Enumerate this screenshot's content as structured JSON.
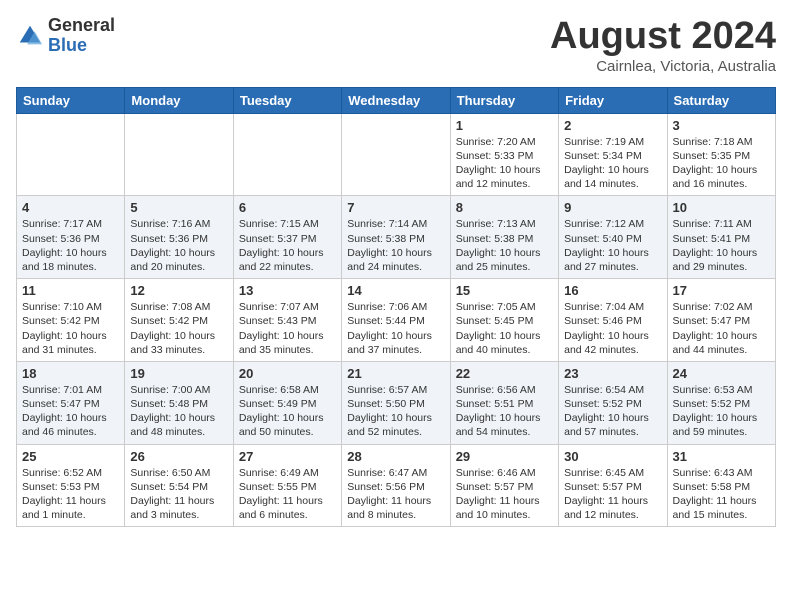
{
  "header": {
    "logo_general": "General",
    "logo_blue": "Blue",
    "month_year": "August 2024",
    "location": "Cairnlea, Victoria, Australia"
  },
  "weekdays": [
    "Sunday",
    "Monday",
    "Tuesday",
    "Wednesday",
    "Thursday",
    "Friday",
    "Saturday"
  ],
  "weeks": [
    [
      {
        "day": "",
        "info": ""
      },
      {
        "day": "",
        "info": ""
      },
      {
        "day": "",
        "info": ""
      },
      {
        "day": "",
        "info": ""
      },
      {
        "day": "1",
        "info": "Sunrise: 7:20 AM\nSunset: 5:33 PM\nDaylight: 10 hours\nand 12 minutes."
      },
      {
        "day": "2",
        "info": "Sunrise: 7:19 AM\nSunset: 5:34 PM\nDaylight: 10 hours\nand 14 minutes."
      },
      {
        "day": "3",
        "info": "Sunrise: 7:18 AM\nSunset: 5:35 PM\nDaylight: 10 hours\nand 16 minutes."
      }
    ],
    [
      {
        "day": "4",
        "info": "Sunrise: 7:17 AM\nSunset: 5:36 PM\nDaylight: 10 hours\nand 18 minutes."
      },
      {
        "day": "5",
        "info": "Sunrise: 7:16 AM\nSunset: 5:36 PM\nDaylight: 10 hours\nand 20 minutes."
      },
      {
        "day": "6",
        "info": "Sunrise: 7:15 AM\nSunset: 5:37 PM\nDaylight: 10 hours\nand 22 minutes."
      },
      {
        "day": "7",
        "info": "Sunrise: 7:14 AM\nSunset: 5:38 PM\nDaylight: 10 hours\nand 24 minutes."
      },
      {
        "day": "8",
        "info": "Sunrise: 7:13 AM\nSunset: 5:38 PM\nDaylight: 10 hours\nand 25 minutes."
      },
      {
        "day": "9",
        "info": "Sunrise: 7:12 AM\nSunset: 5:40 PM\nDaylight: 10 hours\nand 27 minutes."
      },
      {
        "day": "10",
        "info": "Sunrise: 7:11 AM\nSunset: 5:41 PM\nDaylight: 10 hours\nand 29 minutes."
      }
    ],
    [
      {
        "day": "11",
        "info": "Sunrise: 7:10 AM\nSunset: 5:42 PM\nDaylight: 10 hours\nand 31 minutes."
      },
      {
        "day": "12",
        "info": "Sunrise: 7:08 AM\nSunset: 5:42 PM\nDaylight: 10 hours\nand 33 minutes."
      },
      {
        "day": "13",
        "info": "Sunrise: 7:07 AM\nSunset: 5:43 PM\nDaylight: 10 hours\nand 35 minutes."
      },
      {
        "day": "14",
        "info": "Sunrise: 7:06 AM\nSunset: 5:44 PM\nDaylight: 10 hours\nand 37 minutes."
      },
      {
        "day": "15",
        "info": "Sunrise: 7:05 AM\nSunset: 5:45 PM\nDaylight: 10 hours\nand 40 minutes."
      },
      {
        "day": "16",
        "info": "Sunrise: 7:04 AM\nSunset: 5:46 PM\nDaylight: 10 hours\nand 42 minutes."
      },
      {
        "day": "17",
        "info": "Sunrise: 7:02 AM\nSunset: 5:47 PM\nDaylight: 10 hours\nand 44 minutes."
      }
    ],
    [
      {
        "day": "18",
        "info": "Sunrise: 7:01 AM\nSunset: 5:47 PM\nDaylight: 10 hours\nand 46 minutes."
      },
      {
        "day": "19",
        "info": "Sunrise: 7:00 AM\nSunset: 5:48 PM\nDaylight: 10 hours\nand 48 minutes."
      },
      {
        "day": "20",
        "info": "Sunrise: 6:58 AM\nSunset: 5:49 PM\nDaylight: 10 hours\nand 50 minutes."
      },
      {
        "day": "21",
        "info": "Sunrise: 6:57 AM\nSunset: 5:50 PM\nDaylight: 10 hours\nand 52 minutes."
      },
      {
        "day": "22",
        "info": "Sunrise: 6:56 AM\nSunset: 5:51 PM\nDaylight: 10 hours\nand 54 minutes."
      },
      {
        "day": "23",
        "info": "Sunrise: 6:54 AM\nSunset: 5:52 PM\nDaylight: 10 hours\nand 57 minutes."
      },
      {
        "day": "24",
        "info": "Sunrise: 6:53 AM\nSunset: 5:52 PM\nDaylight: 10 hours\nand 59 minutes."
      }
    ],
    [
      {
        "day": "25",
        "info": "Sunrise: 6:52 AM\nSunset: 5:53 PM\nDaylight: 11 hours\nand 1 minute."
      },
      {
        "day": "26",
        "info": "Sunrise: 6:50 AM\nSunset: 5:54 PM\nDaylight: 11 hours\nand 3 minutes."
      },
      {
        "day": "27",
        "info": "Sunrise: 6:49 AM\nSunset: 5:55 PM\nDaylight: 11 hours\nand 6 minutes."
      },
      {
        "day": "28",
        "info": "Sunrise: 6:47 AM\nSunset: 5:56 PM\nDaylight: 11 hours\nand 8 minutes."
      },
      {
        "day": "29",
        "info": "Sunrise: 6:46 AM\nSunset: 5:57 PM\nDaylight: 11 hours\nand 10 minutes."
      },
      {
        "day": "30",
        "info": "Sunrise: 6:45 AM\nSunset: 5:57 PM\nDaylight: 11 hours\nand 12 minutes."
      },
      {
        "day": "31",
        "info": "Sunrise: 6:43 AM\nSunset: 5:58 PM\nDaylight: 11 hours\nand 15 minutes."
      }
    ]
  ]
}
